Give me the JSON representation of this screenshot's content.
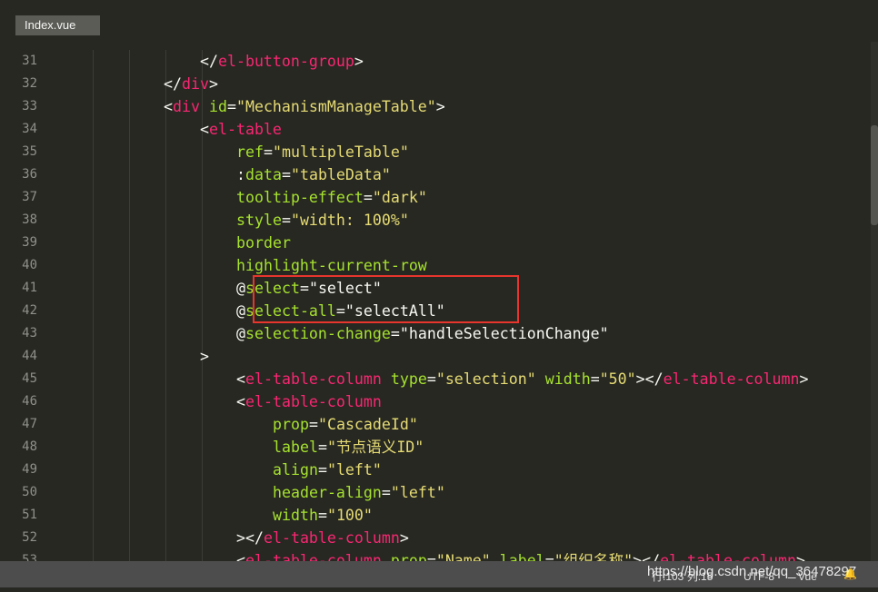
{
  "tab": {
    "label": "Index.vue"
  },
  "status": {
    "position": "行:103  列:15",
    "encoding": "UTF-8",
    "syntax": "Vue"
  },
  "watermark": "https://blog.csdn.net/qq_36478297",
  "lines": [
    {
      "n": "31",
      "indent": 5,
      "tokens": [
        [
          "p",
          "</"
        ],
        [
          "t",
          "el-button-group"
        ],
        [
          "p",
          ">"
        ]
      ]
    },
    {
      "n": "32",
      "indent": 4,
      "tokens": [
        [
          "p",
          "</"
        ],
        [
          "t",
          "div"
        ],
        [
          "p",
          ">"
        ]
      ]
    },
    {
      "n": "33",
      "indent": 4,
      "tokens": [
        [
          "p",
          "<"
        ],
        [
          "t",
          "div"
        ],
        [
          "p",
          " "
        ],
        [
          "a",
          "id"
        ],
        [
          "p",
          "="
        ],
        [
          "s",
          "\"MechanismManageTable\""
        ],
        [
          "p",
          ">"
        ]
      ]
    },
    {
      "n": "34",
      "indent": 5,
      "tokens": [
        [
          "p",
          "<"
        ],
        [
          "t",
          "el-table"
        ]
      ]
    },
    {
      "n": "35",
      "indent": 6,
      "tokens": [
        [
          "a",
          "ref"
        ],
        [
          "p",
          "="
        ],
        [
          "s",
          "\"multipleTable\""
        ]
      ]
    },
    {
      "n": "36",
      "indent": 6,
      "tokens": [
        [
          "p",
          ":"
        ],
        [
          "a",
          "data"
        ],
        [
          "p",
          "="
        ],
        [
          "s",
          "\"tableData\""
        ]
      ]
    },
    {
      "n": "37",
      "indent": 6,
      "tokens": [
        [
          "a",
          "tooltip-effect"
        ],
        [
          "p",
          "="
        ],
        [
          "s",
          "\"dark\""
        ]
      ]
    },
    {
      "n": "38",
      "indent": 6,
      "tokens": [
        [
          "a",
          "style"
        ],
        [
          "p",
          "="
        ],
        [
          "s",
          "\"width: 100%\""
        ]
      ]
    },
    {
      "n": "39",
      "indent": 6,
      "tokens": [
        [
          "a",
          "border"
        ]
      ]
    },
    {
      "n": "40",
      "indent": 6,
      "tokens": [
        [
          "a",
          "highlight-current-row"
        ]
      ]
    },
    {
      "n": "41",
      "indent": 6,
      "tokens": [
        [
          "p",
          "@"
        ],
        [
          "a",
          "select"
        ],
        [
          "p",
          "="
        ],
        [
          "w",
          "\"select\""
        ]
      ]
    },
    {
      "n": "42",
      "indent": 6,
      "tokens": [
        [
          "p",
          "@"
        ],
        [
          "a",
          "select-all"
        ],
        [
          "p",
          "="
        ],
        [
          "w",
          "\"selectAll\""
        ]
      ]
    },
    {
      "n": "43",
      "indent": 6,
      "tokens": [
        [
          "p",
          "@"
        ],
        [
          "a",
          "selection-change"
        ],
        [
          "p",
          "="
        ],
        [
          "w",
          "\"handleSelectionChange\""
        ]
      ]
    },
    {
      "n": "44",
      "indent": 5,
      "tokens": [
        [
          "p",
          ">"
        ]
      ]
    },
    {
      "n": "45",
      "indent": 6,
      "tokens": [
        [
          "p",
          "<"
        ],
        [
          "t",
          "el-table-column"
        ],
        [
          "p",
          " "
        ],
        [
          "a",
          "type"
        ],
        [
          "p",
          "="
        ],
        [
          "s",
          "\"selection\""
        ],
        [
          "p",
          " "
        ],
        [
          "a",
          "width"
        ],
        [
          "p",
          "="
        ],
        [
          "s",
          "\"50\""
        ],
        [
          "p",
          "></"
        ],
        [
          "t",
          "el-table-column"
        ],
        [
          "p",
          ">"
        ]
      ]
    },
    {
      "n": "46",
      "indent": 6,
      "tokens": [
        [
          "p",
          "<"
        ],
        [
          "t",
          "el-table-column"
        ]
      ]
    },
    {
      "n": "47",
      "indent": 7,
      "tokens": [
        [
          "a",
          "prop"
        ],
        [
          "p",
          "="
        ],
        [
          "s",
          "\"CascadeId\""
        ]
      ]
    },
    {
      "n": "48",
      "indent": 7,
      "tokens": [
        [
          "a",
          "label"
        ],
        [
          "p",
          "="
        ],
        [
          "s",
          "\"节点语义ID\""
        ]
      ]
    },
    {
      "n": "49",
      "indent": 7,
      "tokens": [
        [
          "a",
          "align"
        ],
        [
          "p",
          "="
        ],
        [
          "s",
          "\"left\""
        ]
      ]
    },
    {
      "n": "50",
      "indent": 7,
      "tokens": [
        [
          "a",
          "header-align"
        ],
        [
          "p",
          "="
        ],
        [
          "s",
          "\"left\""
        ]
      ]
    },
    {
      "n": "51",
      "indent": 7,
      "tokens": [
        [
          "a",
          "width"
        ],
        [
          "p",
          "="
        ],
        [
          "s",
          "\"100\""
        ]
      ]
    },
    {
      "n": "52",
      "indent": 6,
      "tokens": [
        [
          "p",
          "></"
        ],
        [
          "t",
          "el-table-column"
        ],
        [
          "p",
          ">"
        ]
      ]
    },
    {
      "n": "53",
      "indent": 6,
      "tokens": [
        [
          "p",
          "<"
        ],
        [
          "t",
          "el-table-column"
        ],
        [
          "p",
          " "
        ],
        [
          "a",
          "prop"
        ],
        [
          "p",
          "="
        ],
        [
          "s",
          "\"Name\""
        ],
        [
          "p",
          " "
        ],
        [
          "a",
          "label"
        ],
        [
          "p",
          "="
        ],
        [
          "s",
          "\"组织名称\""
        ],
        [
          "p",
          "></"
        ],
        [
          "t",
          "el-table-column"
        ],
        [
          "p",
          ">"
        ]
      ]
    }
  ]
}
